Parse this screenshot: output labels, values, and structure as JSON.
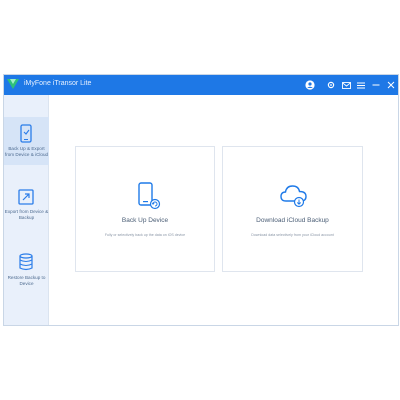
{
  "window": {
    "title": "iMyFone iTransor Lite"
  },
  "sidebar": {
    "items": [
      {
        "label": "Back Up & Export from Device & iCloud",
        "icon": "phone-backup-icon",
        "active": true
      },
      {
        "label": "Export from Device & Backup",
        "icon": "export-icon",
        "active": false
      },
      {
        "label": "Restore Backup to Device",
        "icon": "restore-database-icon",
        "active": false
      }
    ]
  },
  "main": {
    "cards": [
      {
        "title": "Back Up Device",
        "description": "Fully or selectively back up the data on iOS device",
        "icon": "device-backup-icon"
      },
      {
        "title": "Download iCloud Backup",
        "description": "Download data selectively from your iCloud account",
        "icon": "cloud-download-icon"
      }
    ]
  },
  "colors": {
    "titlebar": "#1e78e6",
    "sidebar": "#e9f0fb",
    "sidebar_active": "#d6e4f7",
    "accent": "#1f7ae8",
    "card_border": "#dfe5ee"
  }
}
